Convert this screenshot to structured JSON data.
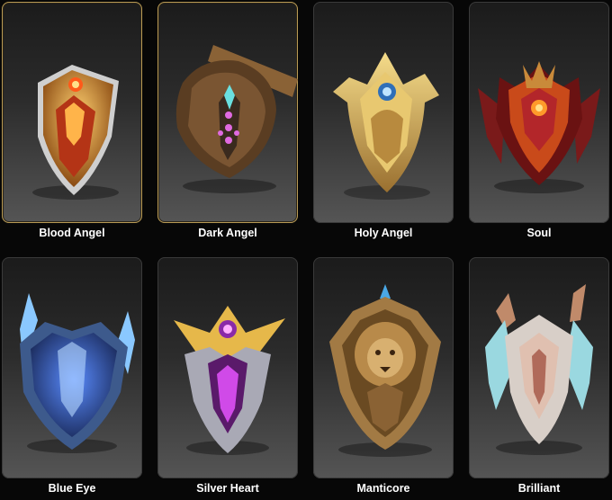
{
  "shields": [
    {
      "name": "Blood Angel",
      "icon": "blood-angel-shield-icon",
      "colors": {
        "metal": "#e0a040",
        "core": "#d94a1a",
        "edge": "#cfcfcf"
      },
      "border": "gold"
    },
    {
      "name": "Dark Angel",
      "icon": "dark-angel-shield-icon",
      "colors": {
        "metal": "#7a5532",
        "core": "#e06ae0",
        "edge": "#9a9a9a"
      },
      "border": "gold"
    },
    {
      "name": "Holy Angel",
      "icon": "holy-angel-shield-icon",
      "colors": {
        "metal": "#d8b25a",
        "core": "#6ab8ff",
        "edge": "#f2e3b0"
      },
      "border": "plain"
    },
    {
      "name": "Soul",
      "icon": "soul-shield-icon",
      "colors": {
        "metal": "#b3262a",
        "core": "#ff9a2a",
        "edge": "#c98a3a"
      },
      "border": "plain"
    },
    {
      "name": "Blue Eye",
      "icon": "blue-eye-shield-icon",
      "colors": {
        "metal": "#3d5a8c",
        "core": "#3b6cff",
        "edge": "#b8d8ff"
      },
      "border": "plain"
    },
    {
      "name": "Silver Heart",
      "icon": "silver-heart-shield-icon",
      "colors": {
        "metal": "#a9a9b5",
        "core": "#d04ae8",
        "edge": "#e6b84a"
      },
      "border": "plain"
    },
    {
      "name": "Manticore",
      "icon": "manticore-shield-icon",
      "colors": {
        "metal": "#a27a44",
        "core": "#4aa8e6",
        "edge": "#e0c48a"
      },
      "border": "plain"
    },
    {
      "name": "Brilliant",
      "icon": "brilliant-shield-icon",
      "colors": {
        "metal": "#9ad8e0",
        "core": "#e0c0b0",
        "edge": "#c08a6a"
      },
      "border": "plain"
    }
  ]
}
